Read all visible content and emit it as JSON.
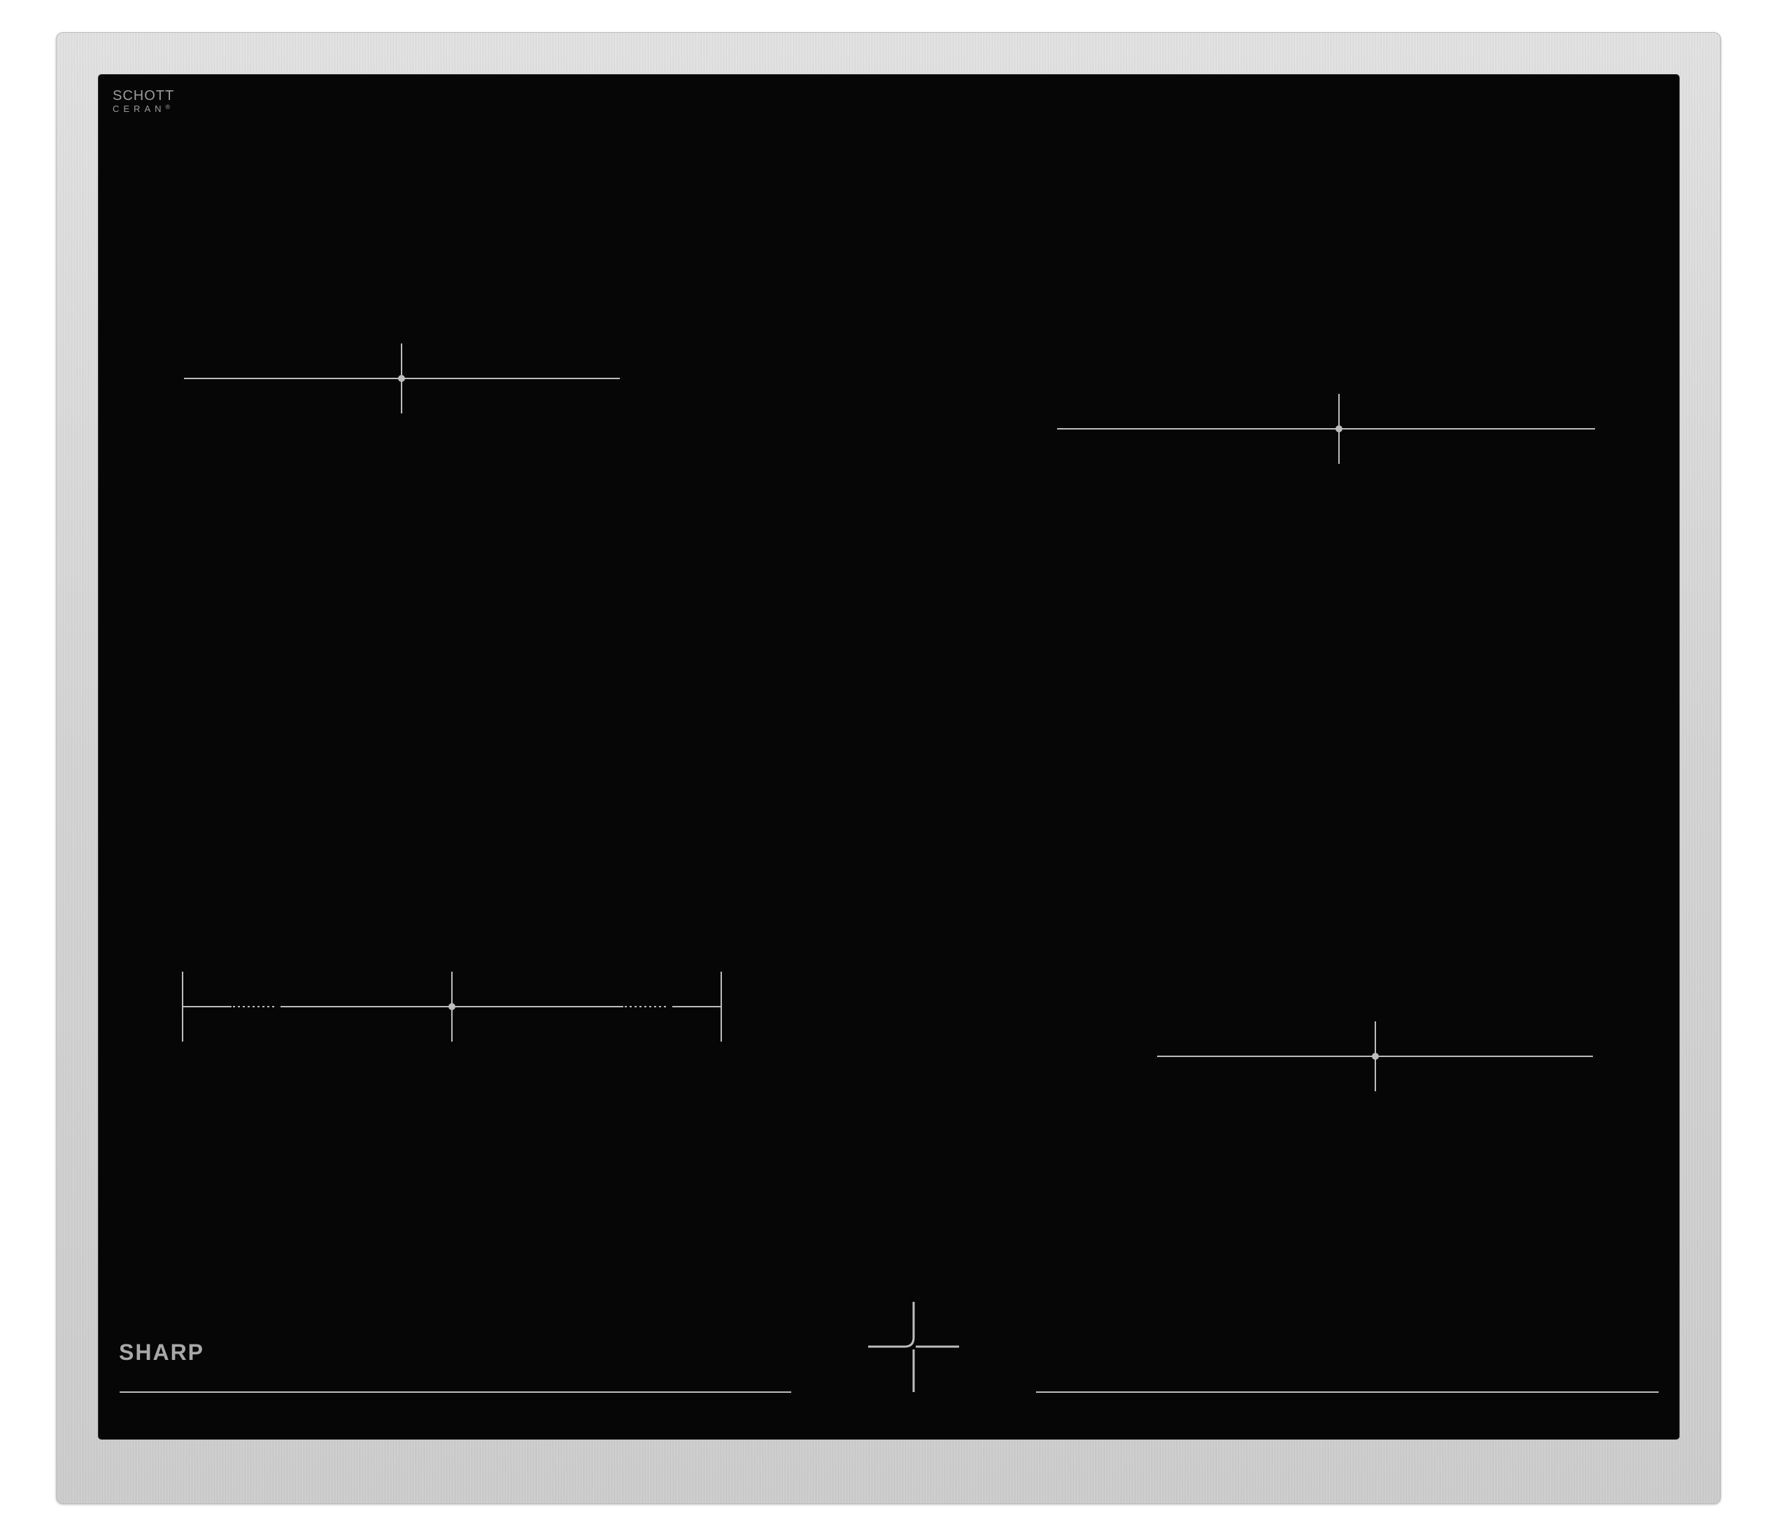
{
  "product": {
    "glass_brand_line1": "SCHOTT",
    "glass_brand_line2": "CERAN",
    "glass_brand_mark": "®",
    "maker_logo": "SHARP"
  },
  "colors": {
    "glass": "#060606",
    "frame": "#d6d6d6",
    "markings": "#bdbdbd"
  },
  "icons": {
    "zone_marker": "crosshair-icon",
    "extended_zone_marker": "dual-ring-marker-icon",
    "control_cross": "control-cross-icon"
  }
}
